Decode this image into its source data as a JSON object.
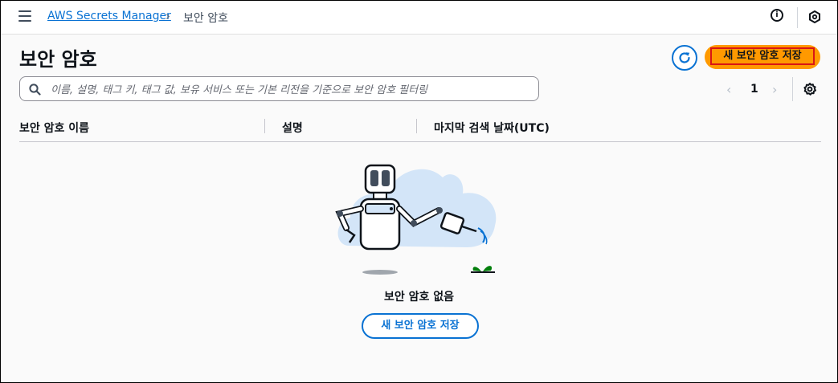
{
  "nav": {
    "breadcrumb_service": "AWS Secrets Manager",
    "breadcrumb_current": "보안 암호",
    "info_label": "i"
  },
  "header": {
    "title": "보안 암호",
    "create_button": "새 보안 암호 저장"
  },
  "search": {
    "placeholder": "이름, 설명, 태그 키, 태그 값, 보유 서비스 또는 기본 리전을 기준으로 보안 암호 필터링"
  },
  "pagination": {
    "current_page": "1",
    "prev_glyph": "‹",
    "next_glyph": "›"
  },
  "table": {
    "columns": [
      "보안 암호 이름",
      "설명",
      "마지막 검색 날짜(UTC)"
    ]
  },
  "empty_state": {
    "message": "보안 암호 없음",
    "button": "새 보안 암호 저장"
  },
  "colors": {
    "accent": "#0972d3",
    "primary": "#ff9900",
    "highlight_border": "#d91515"
  },
  "icons": [
    "hamburger-icon",
    "chevron-right-icon",
    "info-icon",
    "cloudshell-icon",
    "refresh-icon",
    "search-icon",
    "chevron-left-icon",
    "settings-gear-icon"
  ]
}
